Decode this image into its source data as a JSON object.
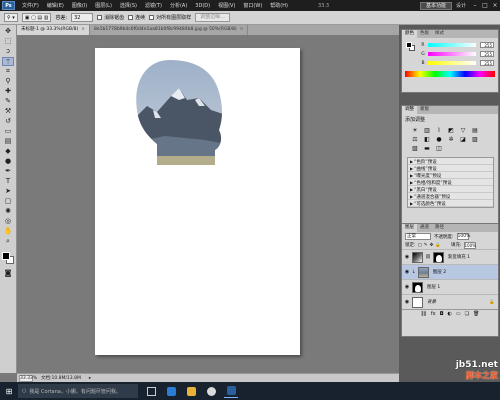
{
  "app": {
    "logo": "Ps",
    "menu": [
      "文件(F)",
      "编辑(E)",
      "图像(I)",
      "图层(L)",
      "选择(S)",
      "滤镜(T)",
      "分析(A)",
      "3D(D)",
      "视图(V)",
      "窗口(W)",
      "帮助(H)"
    ],
    "zoom_readout": "33.3",
    "workspace_label": "基本功能",
    "workspace_right": "设计"
  },
  "options": {
    "feather_label": "容差:",
    "feather_value": "32",
    "antialias": "消除锯齿",
    "contiguous": "连续",
    "sample_all": "对所有图层取样",
    "refine_button": "调整边缘..."
  },
  "tabs": [
    {
      "label": "未标题-1 @ 33.3%(RGB/8)",
      "active": true
    },
    {
      "label": "8e1b1778b9b4c6f0d4e1aa81b0f8c99484b8.jpg @ 50%(RGB/8)",
      "active": false
    }
  ],
  "status": {
    "zoom": "33.33%",
    "doc": "文档:10.8M/13.8M"
  },
  "color_panel": {
    "tabs": [
      "颜色",
      "色板",
      "样式"
    ],
    "channels": [
      {
        "name": "R",
        "value": "255"
      },
      {
        "name": "G",
        "value": "255"
      },
      {
        "name": "B",
        "value": "255"
      }
    ]
  },
  "adjust_panel": {
    "tabs": [
      "调整",
      "蒙版"
    ],
    "title": "添加调整",
    "presets": [
      "“色阶”预设",
      "“曲线”预设",
      "“曝光度”预设",
      "“色相/饱和度”预设",
      "“黑白”预设",
      "“通道混合器”预设",
      "“可选颜色”预设"
    ]
  },
  "layers_panel": {
    "tabs": [
      "图层",
      "通道",
      "路径"
    ],
    "blend_mode": "正常",
    "opacity_label": "不透明度:",
    "opacity": "100%",
    "lock_label": "锁定:",
    "fill_label": "填充:",
    "fill": "100%",
    "layers": [
      {
        "name": "渐变填充 1",
        "thumb": "grad",
        "mask": true,
        "selected": false
      },
      {
        "name": "图层 2",
        "thumb": "photo",
        "mask": false,
        "selected": true
      },
      {
        "name": "图层 1",
        "thumb": "mask",
        "mask": false,
        "selected": false
      },
      {
        "name": "背景",
        "thumb": "white",
        "mask": false,
        "selected": false,
        "locked": true
      }
    ]
  },
  "taskbar": {
    "search_placeholder": "我是 Cortana，小娜。有问题尽管问我。"
  },
  "watermark": {
    "site": "jb51.net",
    "name": "脚本之家"
  }
}
